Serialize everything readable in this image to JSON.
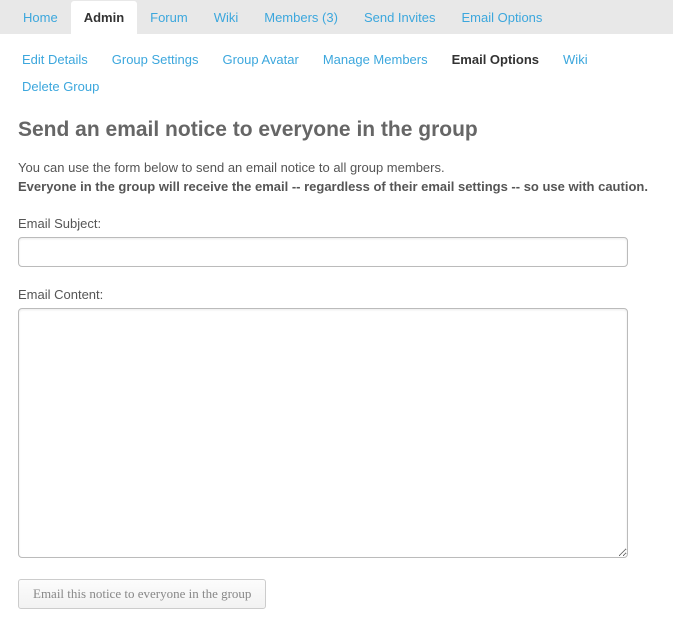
{
  "topnav": {
    "items": [
      {
        "label": "Home"
      },
      {
        "label": "Admin"
      },
      {
        "label": "Forum"
      },
      {
        "label": "Wiki"
      },
      {
        "label": "Members (3)"
      },
      {
        "label": "Send Invites"
      },
      {
        "label": "Email Options"
      }
    ],
    "active_index": 1
  },
  "subnav": {
    "items": [
      {
        "label": "Edit Details"
      },
      {
        "label": "Group Settings"
      },
      {
        "label": "Group Avatar"
      },
      {
        "label": "Manage Members"
      },
      {
        "label": "Email Options"
      },
      {
        "label": "Wiki"
      },
      {
        "label": "Delete Group"
      }
    ],
    "active_index": 4
  },
  "page": {
    "title": "Send an email notice to everyone in the group",
    "instruction": "You can use the form below to send an email notice to all group members.",
    "warning": "Everyone in the group will receive the email -- regardless of their email settings -- so use with caution."
  },
  "form": {
    "subject_label": "Email Subject:",
    "subject_value": "",
    "content_label": "Email Content:",
    "content_value": "",
    "submit_label": "Email this notice to everyone in the group"
  }
}
